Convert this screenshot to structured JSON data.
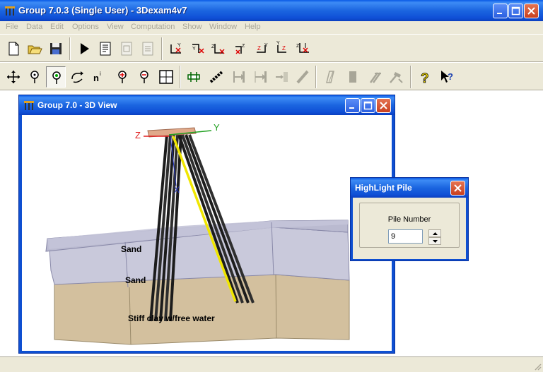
{
  "app": {
    "title": "Group 7.0.3 (Single User) - 3Dexam4v7",
    "window_buttons": [
      "minimize",
      "maximize",
      "close"
    ]
  },
  "menu": [
    "File",
    "Data",
    "Edit",
    "Options",
    "View",
    "Computation",
    "Show",
    "Window",
    "Help"
  ],
  "toolbar1": [
    {
      "name": "new-file-icon"
    },
    {
      "name": "open-folder-icon"
    },
    {
      "name": "save-disk-icon"
    },
    {
      "name": "run-play-icon"
    },
    {
      "name": "report-page-icon"
    },
    {
      "name": "disabled-page-icon"
    },
    {
      "name": "disabled-page-2-icon"
    },
    {
      "name": "view-xy-icon"
    },
    {
      "name": "view-yx-icon"
    },
    {
      "name": "view-zx-icon"
    },
    {
      "name": "view-xz-icon"
    },
    {
      "name": "view-zy-icon"
    },
    {
      "name": "view-yz-icon"
    },
    {
      "name": "view-zxy-icon"
    }
  ],
  "toolbar2": [
    {
      "name": "move-arrows-icon"
    },
    {
      "name": "pin-icon"
    },
    {
      "name": "pin-highlight-icon"
    },
    {
      "name": "rotate-hand-icon"
    },
    {
      "name": "pile-number-icon"
    },
    {
      "name": "pin-plus-icon"
    },
    {
      "name": "pin-minus-icon"
    },
    {
      "name": "grid-view-icon"
    },
    {
      "name": "pile-cap-icon"
    },
    {
      "name": "chain-icon"
    },
    {
      "name": "disabled-bar-icon"
    },
    {
      "name": "disabled-bar-2-icon"
    },
    {
      "name": "disabled-dots-icon"
    },
    {
      "name": "disabled-slash-icon"
    },
    {
      "name": "disabled-deflect-icon"
    },
    {
      "name": "disabled-block-icon"
    },
    {
      "name": "disabled-pile-icon"
    },
    {
      "name": "disabled-hammer-icon"
    },
    {
      "name": "help-question-icon"
    },
    {
      "name": "context-help-icon"
    }
  ],
  "child_window": {
    "title": "Group 7.0 - 3D View",
    "axes": {
      "y": "Y",
      "z": "Z",
      "x": "X"
    },
    "layers": [
      "Sand",
      "Sand",
      "Stiff clay w/free water"
    ]
  },
  "dialog": {
    "title": "HighLight Pile",
    "label": "Pile Number",
    "value": "9"
  },
  "colors": {
    "title_blue": "#1b65e0",
    "sand_fill": "#c9c9dd",
    "clay_fill": "#d2bf9c",
    "pile_dark": "#1c1c1c",
    "pile_highlight": "#f0e600"
  }
}
